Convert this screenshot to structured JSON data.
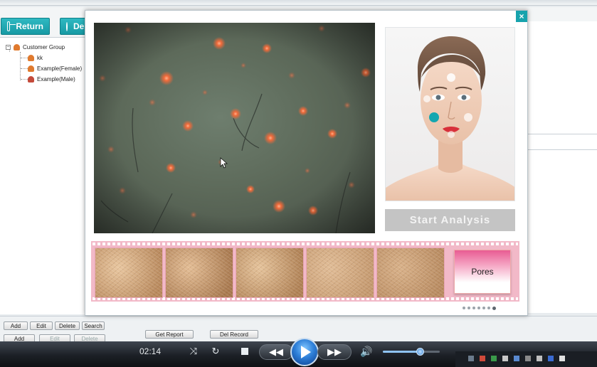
{
  "toolbar": {
    "return_label": "Return",
    "detect_label": "De"
  },
  "tree": {
    "root": "Customer Group",
    "items": [
      {
        "label": "kk"
      },
      {
        "label": "Example(Female)"
      },
      {
        "label": "Example(Male)"
      }
    ]
  },
  "tree_buttons": {
    "add": "Add",
    "edit": "Edit",
    "delete": "Delete",
    "search": "Search"
  },
  "record_buttons": {
    "add": "Add",
    "edit": "Edit",
    "delete": "Delete"
  },
  "report_buttons": {
    "get_report": "Get Report",
    "del_record": "Del Record"
  },
  "modal": {
    "close_glyph": "×",
    "start_analysis": "Start Analysis",
    "pores_label": "Pores",
    "thumbnail_count": 5,
    "pager": {
      "pages": 7,
      "active_index": 6
    }
  },
  "player": {
    "time": "02:14",
    "volume_fraction": 0.66
  },
  "colors": {
    "accent_teal": "#17a3ad",
    "film_pink": "#f2b9c8",
    "pores_pink": "#e85c93"
  }
}
